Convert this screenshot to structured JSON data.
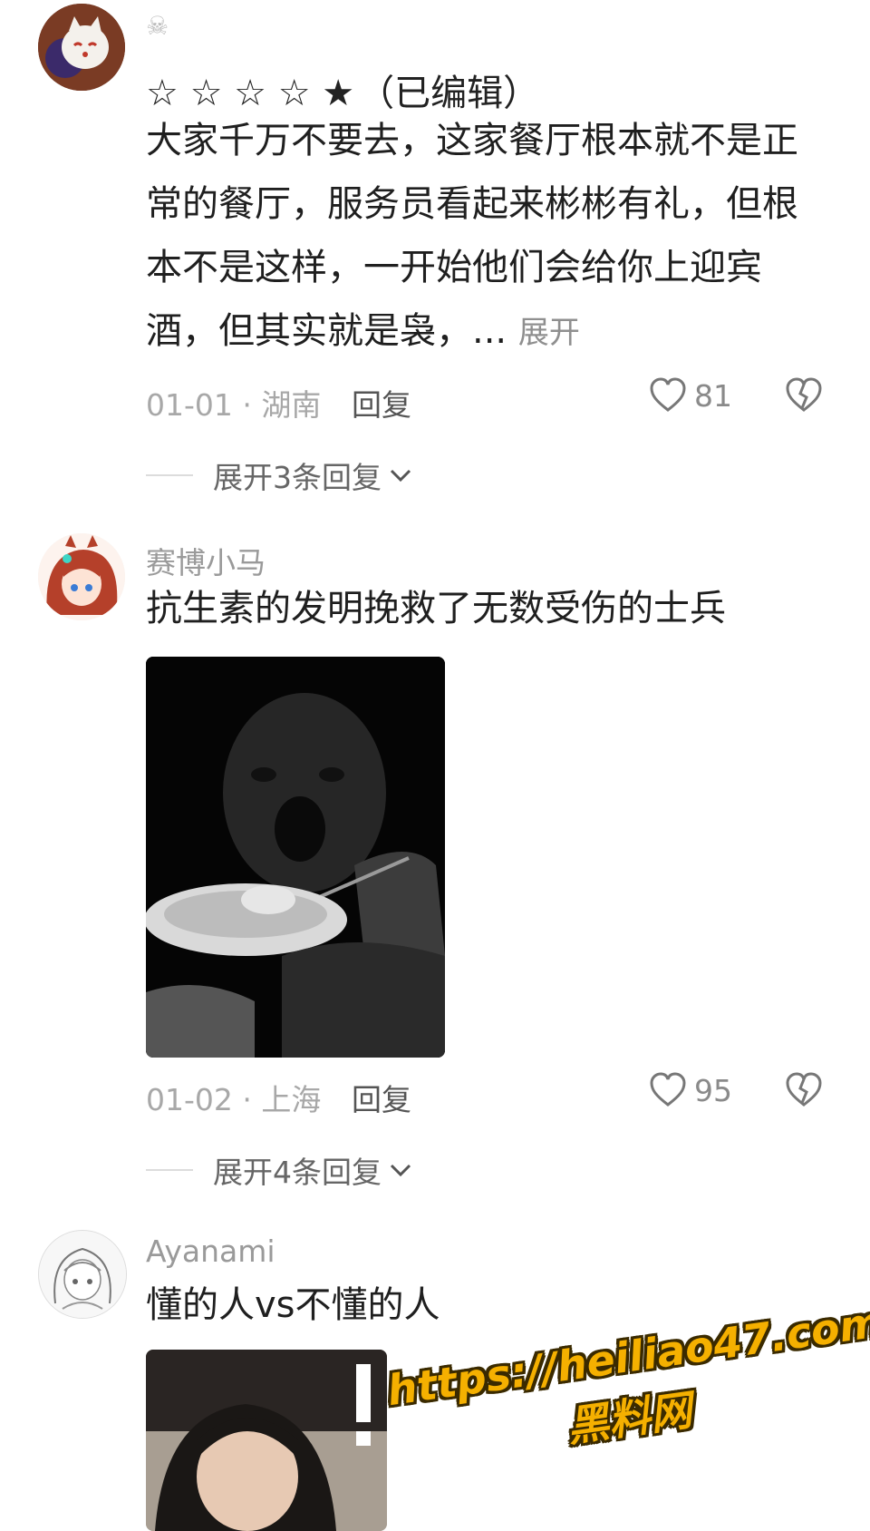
{
  "comments": [
    {
      "username": "☠",
      "rating_display": "☆ ☆ ☆ ☆ ★",
      "edited_label": "（已编辑）",
      "text": "大家千万不要去，这家餐厅根本就不是正常的餐厅，服务员看起来彬彬有礼，但根本不是这样，一开始他们会给你上迎宾酒，但其实就是袅，... ",
      "more_label": "展开",
      "date_location": "01-01 · 湖南",
      "reply_label": "回复",
      "likes": "81",
      "expand_label": "展开3条回复"
    },
    {
      "username": "赛博小马",
      "text": "抗生素的发明挽救了无数受伤的士兵",
      "date_location": "01-02 · 上海",
      "reply_label": "回复",
      "likes": "95",
      "expand_label": "展开4条回复"
    },
    {
      "username": "Ayanami",
      "text": "懂的人vs不懂的人"
    }
  ],
  "watermark": {
    "url": "https://heiliao47.com",
    "name": "黑料网"
  },
  "icons": {
    "like": "heart-outline-icon",
    "dislike": "broken-heart-icon",
    "chevron": "chevron-down-icon"
  }
}
